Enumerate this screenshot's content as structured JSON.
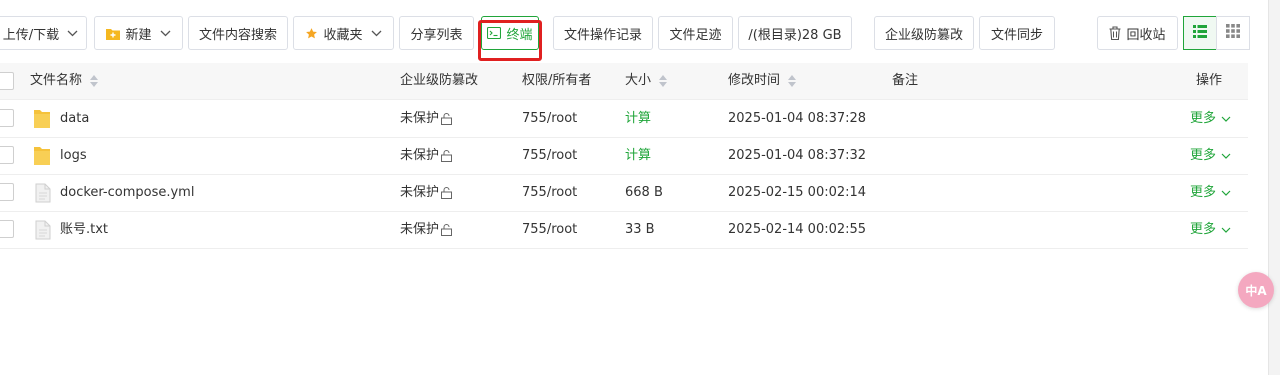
{
  "toolbar": {
    "upload_download": "上传/下载",
    "new": "新建",
    "content_search": "文件内容搜索",
    "favorites": "收藏夹",
    "share_list": "分享列表",
    "terminal": "终端",
    "operation_log": "文件操作记录",
    "footprint": "文件足迹",
    "disk": "/(根目录)28 GB",
    "tamper_proof": "企业级防篡改",
    "file_sync": "文件同步",
    "recycle_bin": "回收站"
  },
  "table": {
    "headers": {
      "name": "文件名称",
      "protect": "企业级防篡改",
      "perm": "权限/所有者",
      "size": "大小",
      "mtime": "修改时间",
      "note": "备注",
      "ops": "操作"
    },
    "rows": [
      {
        "name": "data",
        "type": "folder",
        "protect": "未保护",
        "perm": "755/root",
        "size": "计算",
        "mtime": "2025-01-04 08:37:28",
        "more": "更多"
      },
      {
        "name": "logs",
        "type": "folder",
        "protect": "未保护",
        "perm": "755/root",
        "size": "计算",
        "mtime": "2025-01-04 08:37:32",
        "more": "更多"
      },
      {
        "name": "docker-compose.yml",
        "type": "file",
        "protect": "未保护",
        "perm": "755/root",
        "size": "668 B",
        "mtime": "2025-02-15 00:02:14",
        "more": "更多"
      },
      {
        "name": "账号.txt",
        "type": "file",
        "protect": "未保护",
        "perm": "755/root",
        "size": "33 B",
        "mtime": "2025-02-14 00:02:55",
        "more": "更多"
      }
    ]
  },
  "fab": {
    "label": "中A"
  },
  "colors": {
    "accent": "#20a53a",
    "highlight": "#e02020"
  }
}
